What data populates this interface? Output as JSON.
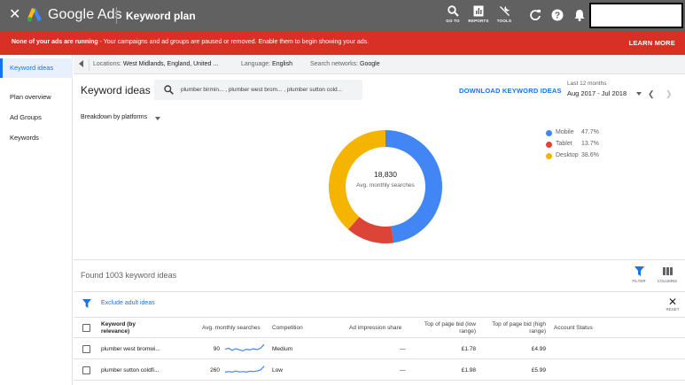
{
  "header": {
    "brand": "Google Ads",
    "page_title": "Keyword plan",
    "tools": [
      {
        "label": "GO TO",
        "icon": "search-icon"
      },
      {
        "label": "REPORTS",
        "icon": "reports-icon"
      },
      {
        "label": "TOOLS",
        "icon": "wrench-icon"
      }
    ]
  },
  "banner": {
    "bold": "None of your ads are running",
    "text": " - Your campaigns and ad groups are paused or removed. Enable them to begin showing your ads.",
    "action": "LEARN MORE"
  },
  "sidebar": {
    "items": [
      {
        "label": "Keyword ideas",
        "active": true
      },
      {
        "label": "Plan overview"
      },
      {
        "label": "Ad Groups"
      },
      {
        "label": "Keywords"
      }
    ]
  },
  "filters": {
    "locations_label": "Locations:",
    "locations_value": "West Midlands, England, United ...",
    "language_label": "Language:",
    "language_value": "English",
    "networks_label": "Search networks:",
    "networks_value": "Google"
  },
  "main": {
    "title": "Keyword ideas",
    "search_query": "plumber birmin... , plumber west brom... , plumber sutton cold...",
    "download": "DOWNLOAD KEYWORD IDEAS",
    "range_label": "Last 12 months",
    "range_value": "Aug 2017 - Jul 2018",
    "breakdown": "Breakdown by platforms"
  },
  "chart_data": {
    "type": "pie",
    "center_value": "18,830",
    "center_label": "Avg. monthly searches",
    "series": [
      {
        "name": "Mobile",
        "value": 47.7,
        "pct": "47.7%",
        "color": "#4285f4"
      },
      {
        "name": "Tablet",
        "value": 13.7,
        "pct": "13.7%",
        "color": "#db4437"
      },
      {
        "name": "Desktop",
        "value": 38.6,
        "pct": "38.6%",
        "color": "#f4b400"
      }
    ]
  },
  "results": {
    "found": "Found 1003 keyword ideas",
    "filter": "FILTER",
    "columns": "COLUMNS",
    "exclude": "Exclude adult ideas",
    "reset": "RESET"
  },
  "table": {
    "headers": {
      "keyword": "Keyword (by relevance)",
      "searches": "Avg. monthly searches",
      "competition": "Competition",
      "impression": "Ad impression share",
      "bid_low": "Top of page bid (low range)",
      "bid_high": "Top of page bid (high range)",
      "status": "Account Status"
    },
    "rows": [
      {
        "keyword": "plumber west bromwi...",
        "searches": "90",
        "competition": "Medium",
        "impression": "—",
        "bid_low": "£1.78",
        "bid_high": "£4.99",
        "trend": [
          0.45,
          0.55,
          0.35,
          0.5,
          0.4,
          0.3,
          0.45,
          0.38,
          0.5,
          0.42,
          0.55,
          0.9
        ]
      },
      {
        "keyword": "plumber sutton coldfi...",
        "searches": "260",
        "competition": "Low",
        "impression": "—",
        "bid_low": "£1.98",
        "bid_high": "£5.99",
        "trend": [
          0.3,
          0.35,
          0.3,
          0.4,
          0.32,
          0.35,
          0.3,
          0.38,
          0.35,
          0.4,
          0.5,
          0.85
        ]
      }
    ]
  },
  "colors": {
    "header_bg": "#616161",
    "banner_bg": "#d93025",
    "accent": "#1a73e8"
  }
}
